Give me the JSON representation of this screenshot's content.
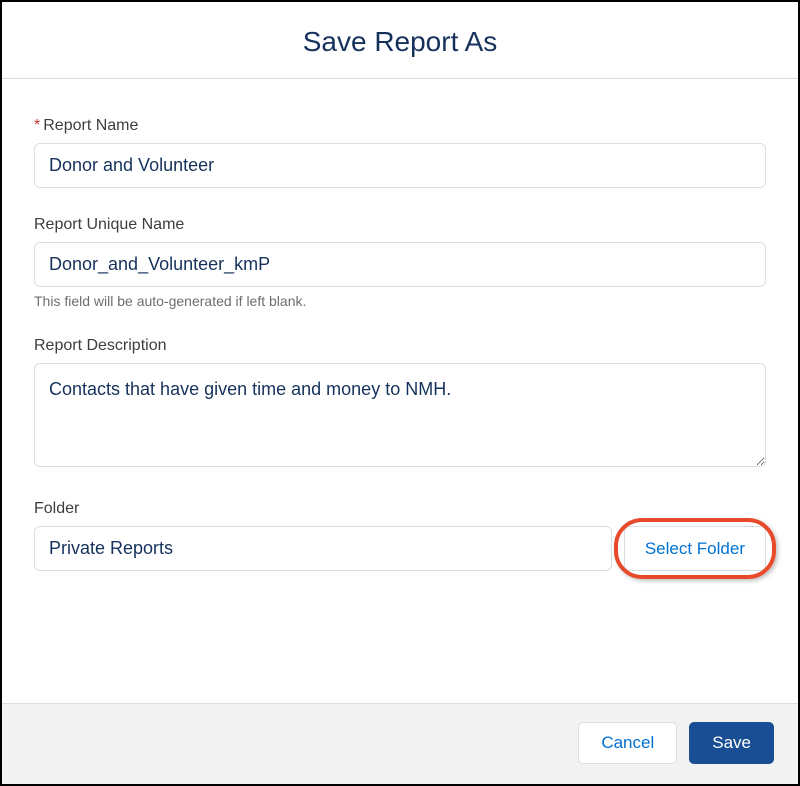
{
  "dialog": {
    "title": "Save Report As",
    "fields": {
      "report_name": {
        "label": "Report Name",
        "required_mark": "*",
        "value": "Donor and Volunteer"
      },
      "unique_name": {
        "label": "Report Unique Name",
        "value": "Donor_and_Volunteer_kmP",
        "helper": "This field will be auto-generated if left blank."
      },
      "description": {
        "label": "Report Description",
        "value": "Contacts that have given time and money to NMH."
      },
      "folder": {
        "label": "Folder",
        "value": "Private Reports",
        "select_button": "Select Folder"
      }
    },
    "footer": {
      "cancel": "Cancel",
      "save": "Save"
    }
  }
}
